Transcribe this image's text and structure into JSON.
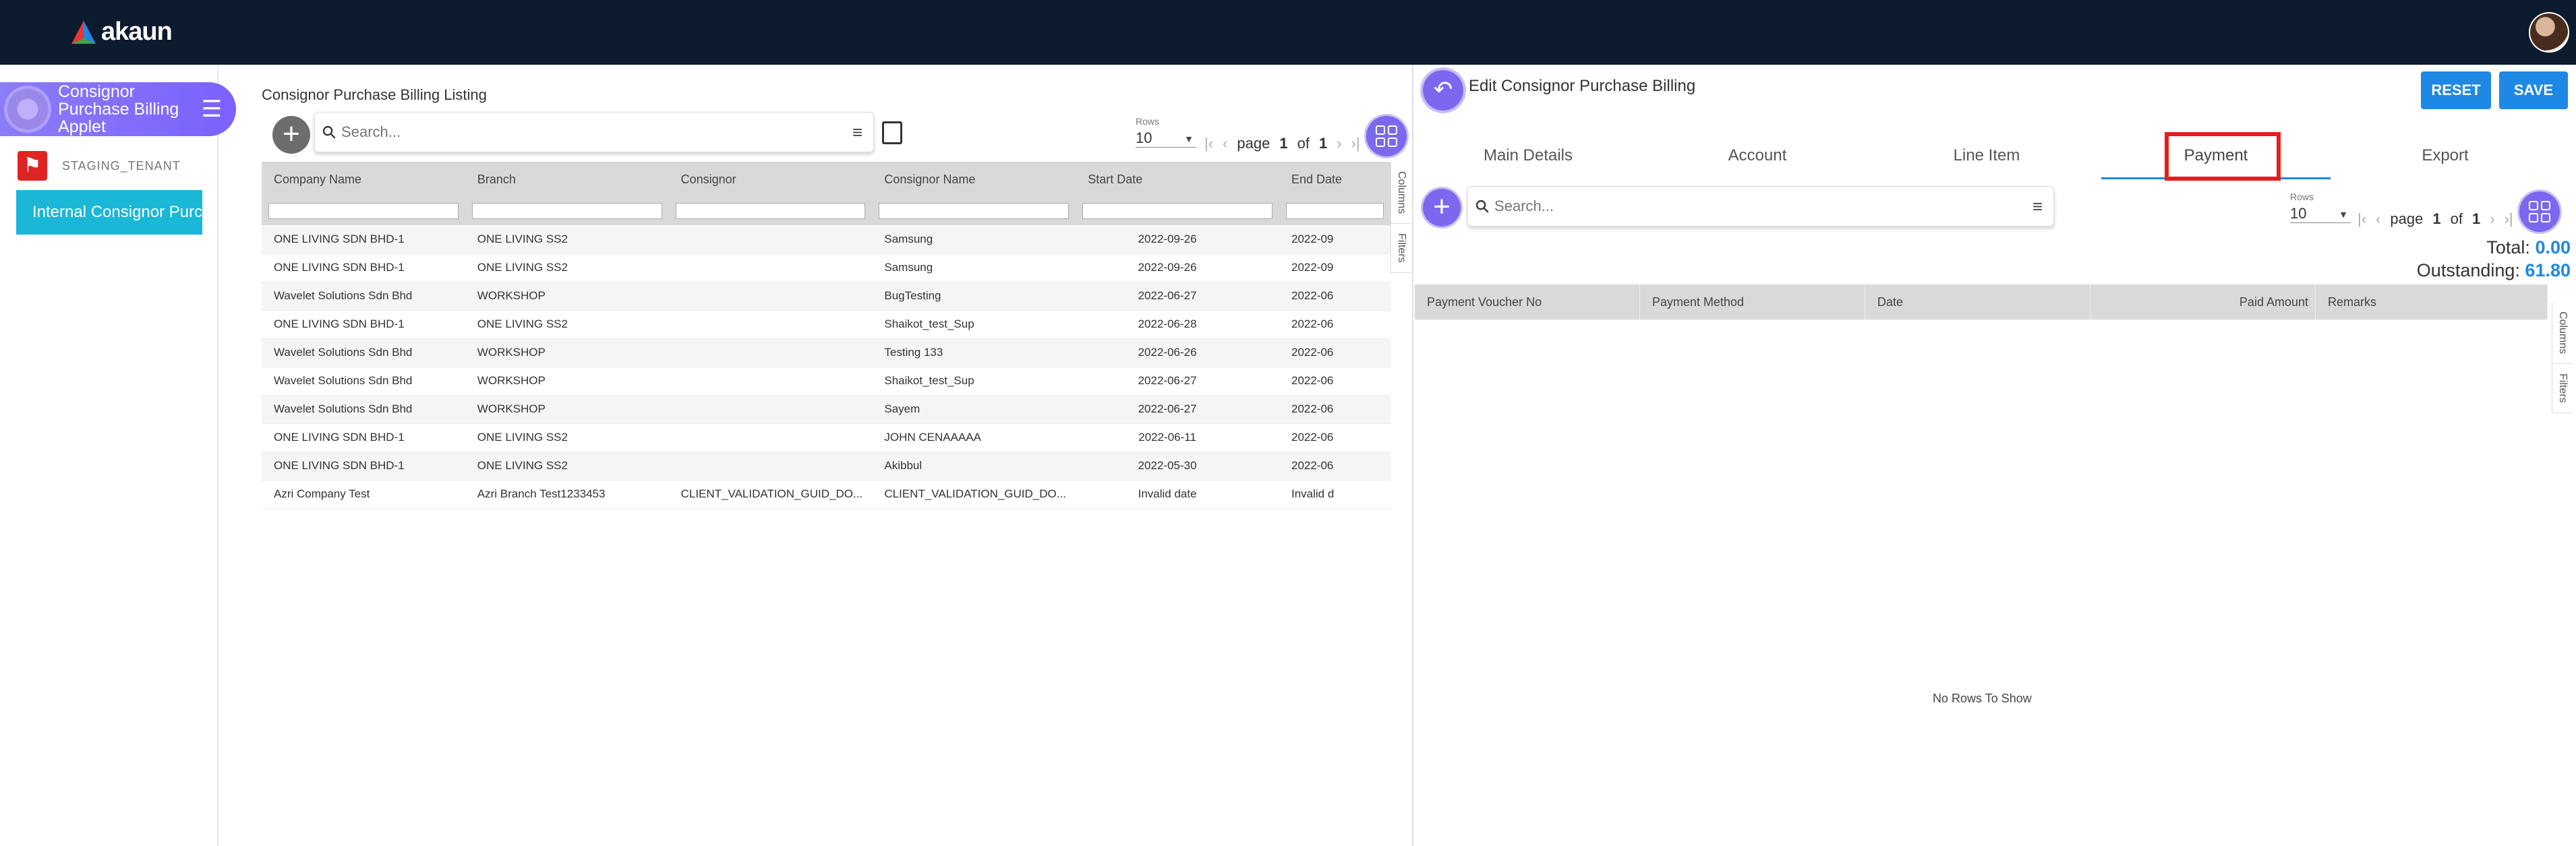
{
  "app": {
    "logo_text": "akaun"
  },
  "sidebar": {
    "applet_title": "Consignor Purchase Billing Applet",
    "tenant_name": "STAGING_TENANT",
    "internal_button": "Internal Consignor Purchase Billing"
  },
  "listing": {
    "title": "Consignor Purchase Billing Listing",
    "search_placeholder": "Search...",
    "rows_label": "Rows",
    "rows_value": "10",
    "page_word": "page",
    "page_current": "1",
    "page_of": "of",
    "page_total": "1",
    "columns": [
      "Company Name",
      "Branch",
      "Consignor",
      "Consignor Name",
      "Start Date",
      "End Date"
    ],
    "rows": [
      [
        "ONE LIVING SDN BHD-1",
        "ONE LIVING SS2",
        "",
        "Samsung",
        "2022-09-26",
        "2022-09"
      ],
      [
        "ONE LIVING SDN BHD-1",
        "ONE LIVING SS2",
        "",
        "Samsung",
        "2022-09-26",
        "2022-09"
      ],
      [
        "Wavelet Solutions Sdn Bhd",
        "WORKSHOP",
        "",
        "BugTesting",
        "2022-06-27",
        "2022-06"
      ],
      [
        "ONE LIVING SDN BHD-1",
        "ONE LIVING SS2",
        "",
        "Shaikot_test_Sup",
        "2022-06-28",
        "2022-06"
      ],
      [
        "Wavelet Solutions Sdn Bhd",
        "WORKSHOP",
        "",
        "Testing 133",
        "2022-06-26",
        "2022-06"
      ],
      [
        "Wavelet Solutions Sdn Bhd",
        "WORKSHOP",
        "",
        "Shaikot_test_Sup",
        "2022-06-27",
        "2022-06"
      ],
      [
        "Wavelet Solutions Sdn Bhd",
        "WORKSHOP",
        "",
        "Sayem",
        "2022-06-27",
        "2022-06"
      ],
      [
        "ONE LIVING SDN BHD-1",
        "ONE LIVING SS2",
        "",
        "JOHN CENAAAAA",
        "2022-06-11",
        "2022-06"
      ],
      [
        "ONE LIVING SDN BHD-1",
        "ONE LIVING SS2",
        "",
        "Akibbul",
        "2022-05-30",
        "2022-06"
      ],
      [
        "Azri Company Test",
        "Azri Branch Test1233453",
        "CLIENT_VALIDATION_GUID_DO...",
        "CLIENT_VALIDATION_GUID_DO...",
        "Invalid date",
        "Invalid d"
      ]
    ],
    "side_tabs": [
      "Columns",
      "Filters"
    ]
  },
  "edit": {
    "title": "Edit Consignor Purchase Billing",
    "reset_label": "RESET",
    "save_label": "SAVE",
    "tabs": [
      "Main Details",
      "Account",
      "Line Item",
      "Payment",
      "Export"
    ],
    "active_tab": "Payment",
    "search_placeholder": "Search...",
    "rows_label": "Rows",
    "rows_value": "10",
    "page_word": "page",
    "page_current": "1",
    "page_of": "of",
    "page_total": "1",
    "total_label": "Total:",
    "total_value": "0.00",
    "outstanding_label": "Outstanding:",
    "outstanding_value": "61.80",
    "columns": [
      "Payment Voucher No",
      "Payment Method",
      "Date",
      "Paid Amount",
      "Remarks"
    ],
    "empty_text": "No Rows To Show",
    "side_tabs": [
      "Columns",
      "Filters"
    ]
  },
  "colors": {
    "topbar": "#0d1b2e",
    "accent": "#7b68ee",
    "primary": "#1e88e5",
    "highlight": "#e81c1c",
    "internal": "#1ab7d6"
  }
}
